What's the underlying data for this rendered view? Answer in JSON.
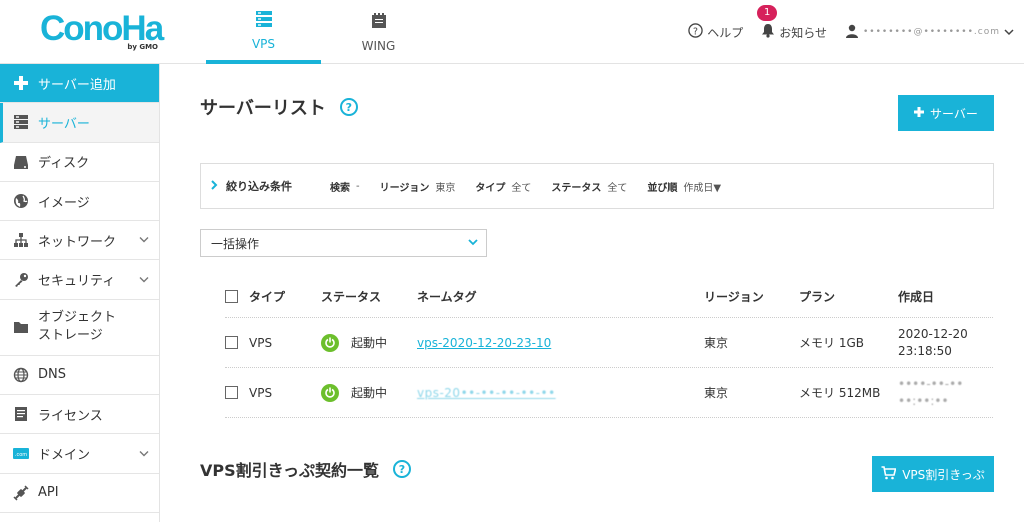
{
  "header": {
    "logo_text": "ConoHa",
    "logo_sub": "by GMO",
    "tabs": [
      {
        "label": "VPS",
        "icon": "server-icon",
        "active": true
      },
      {
        "label": "WING",
        "icon": "wing-icon",
        "active": false
      }
    ],
    "help_label": "ヘルプ",
    "notice_label": "お知らせ",
    "notice_count": "1",
    "username": "••••••••@••••••••.com"
  },
  "sidebar": {
    "items": [
      {
        "label": "サーバー追加",
        "icon": "plus-icon"
      },
      {
        "label": "サーバー",
        "icon": "server-icon"
      },
      {
        "label": "ディスク",
        "icon": "disk-icon"
      },
      {
        "label": "イメージ",
        "icon": "image-icon"
      },
      {
        "label": "ネットワーク",
        "icon": "network-icon"
      },
      {
        "label": "セキュリティ",
        "icon": "key-icon"
      },
      {
        "label": "オブジェクト\nストレージ",
        "icon": "folder-icon"
      },
      {
        "label": "DNS",
        "icon": "globe-icon"
      },
      {
        "label": "ライセンス",
        "icon": "license-icon"
      },
      {
        "label": "ドメイン",
        "icon": "domain-icon"
      },
      {
        "label": "API",
        "icon": "api-icon"
      }
    ]
  },
  "main": {
    "title": "サーバーリスト",
    "help_mark": "?",
    "add_server_label": "サーバー",
    "filter": {
      "title": "絞り込み条件",
      "search_key": "検索",
      "search_val": "-",
      "region_key": "リージョン",
      "region_val": "東京",
      "type_key": "タイプ",
      "type_val": "全て",
      "status_key": "ステータス",
      "status_val": "全て",
      "sort_key": "並び順",
      "sort_val": "作成日▼"
    },
    "bulk_label": "一括操作",
    "table": {
      "headers": {
        "type": "タイプ",
        "status": "ステータス",
        "nametag": "ネームタグ",
        "region": "リージョン",
        "plan": "プラン",
        "created": "作成日"
      },
      "rows": [
        {
          "type": "VPS",
          "status": "起動中",
          "nametag": "vps-2020-12-20-23-10",
          "region": "東京",
          "plan": "メモリ 1GB",
          "created_date": "2020-12-20",
          "created_time": "23:18:50"
        },
        {
          "type": "VPS",
          "status": "起動中",
          "nametag": "vps-20••-••-••-••-••",
          "region": "東京",
          "plan": "メモリ 512MB",
          "created_date": "••••-••-••",
          "created_time": "••:••:••"
        }
      ]
    },
    "section2_title": "VPS割引きっぷ契約一覧",
    "ticket_button_label": "VPS割引きっぷ"
  }
}
